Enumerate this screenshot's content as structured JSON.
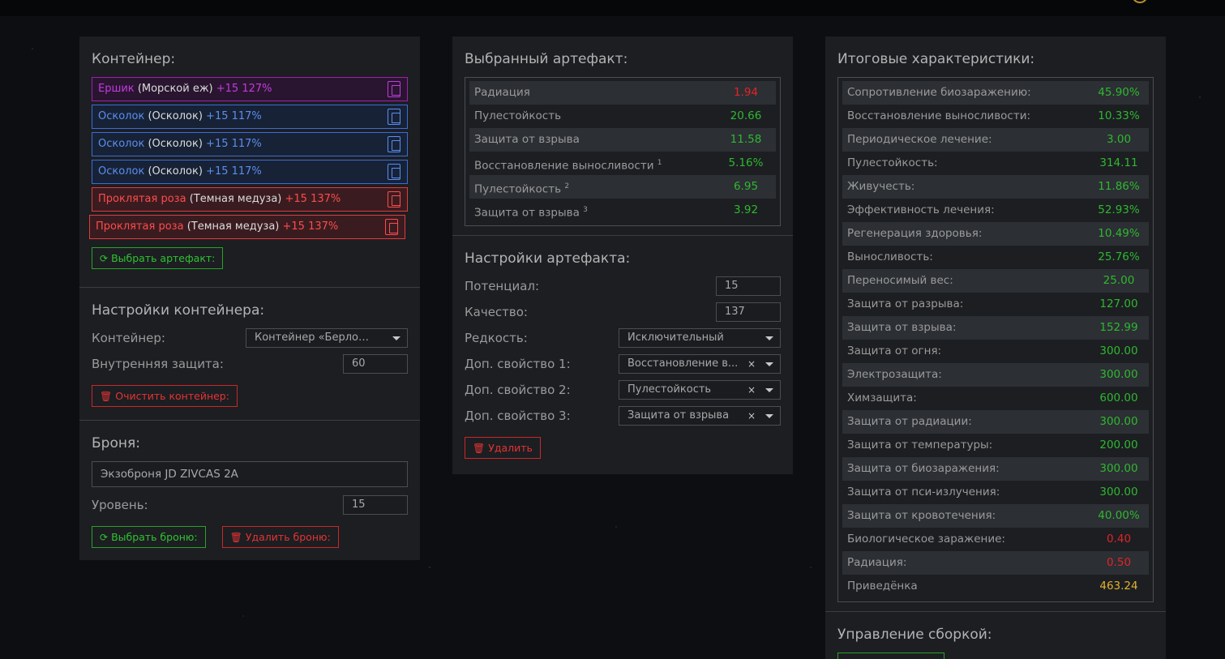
{
  "container_panel": {
    "title": "Контейнер:",
    "items": [
      {
        "name": "Ершик",
        "base": "(Морской еж)",
        "level": "+15 127%",
        "color": "purple"
      },
      {
        "name": "Осколок",
        "base": "(Осколок)",
        "level": "+15 117%",
        "color": "blue"
      },
      {
        "name": "Осколок",
        "base": "(Осколок)",
        "level": "+15 117%",
        "color": "blue"
      },
      {
        "name": "Осколок",
        "base": "(Осколок)",
        "level": "+15 117%",
        "color": "blue"
      },
      {
        "name": "Проклятая роза",
        "base": "(Темная медуза)",
        "level": "+15 137%",
        "color": "red"
      },
      {
        "name": "Проклятая роза",
        "base": "(Темная медуза)",
        "level": "+15 137%",
        "color": "red"
      }
    ],
    "select_artifact_button": "Выбрать артефакт:",
    "settings_title": "Настройки контейнера:",
    "container_label": "Контейнер:",
    "container_value": "Контейнер «Берлога...",
    "inner_protection_label": "Внутренняя защита:",
    "inner_protection_value": "60",
    "clear_button": "Очистить контейнер:"
  },
  "armor_panel": {
    "title": "Броня:",
    "armor_value": "Экзоброня JD ZIVCAS 2A",
    "level_label": "Уровень:",
    "level_value": "15",
    "select_button": "Выбрать броню:",
    "delete_button": "Удалить броню:"
  },
  "artifact_panel": {
    "title": "Выбранный артефакт:",
    "stats": [
      {
        "label": "Радиация",
        "sup": "",
        "value": "1.94",
        "color": "red"
      },
      {
        "label": "Пулестойкость",
        "sup": "",
        "value": "20.66",
        "color": "green"
      },
      {
        "label": "Защита от взрыва",
        "sup": "",
        "value": "11.58",
        "color": "green"
      },
      {
        "label": "Восстановление выносливости",
        "sup": "1",
        "value": "5.16%",
        "color": "green"
      },
      {
        "label": "Пулестойкость",
        "sup": "2",
        "value": "6.95",
        "color": "green"
      },
      {
        "label": "Защита от взрыва",
        "sup": "3",
        "value": "3.92",
        "color": "green"
      }
    ],
    "settings_title": "Настройки артефакта:",
    "potential_label": "Потенциал:",
    "potential_value": "15",
    "quality_label": "Качество:",
    "quality_value": "137",
    "rarity_label": "Редкость:",
    "rarity_value": "Исключительный",
    "extra1_label": "Доп. свойство 1:",
    "extra1_value": "Восстановление в...",
    "extra2_label": "Доп. свойство 2:",
    "extra2_value": "Пулестойкость",
    "extra3_label": "Доп. свойство 3:",
    "extra3_value": "Защита от взрыва",
    "clear_x": "×",
    "delete_button": "Удалить"
  },
  "totals_panel": {
    "title": "Итоговые характеристики:",
    "stats": [
      {
        "label": "Сопротивление биозаражению:",
        "value": "45.90%",
        "color": "green"
      },
      {
        "label": "Восстановление выносливости:",
        "value": "10.33%",
        "color": "green"
      },
      {
        "label": "Периодическое лечение:",
        "value": "3.00",
        "color": "green"
      },
      {
        "label": "Пулестойкость:",
        "value": "314.11",
        "color": "green"
      },
      {
        "label": "Живучесть:",
        "value": "11.86%",
        "color": "green"
      },
      {
        "label": "Эффективность лечения:",
        "value": "52.93%",
        "color": "green"
      },
      {
        "label": "Регенерация здоровья:",
        "value": "10.49%",
        "color": "green"
      },
      {
        "label": "Выносливость:",
        "value": "25.76%",
        "color": "green"
      },
      {
        "label": "Переносимый вес:",
        "value": "25.00",
        "color": "green"
      },
      {
        "label": "Защита от разрыва:",
        "value": "127.00",
        "color": "green"
      },
      {
        "label": "Защита от взрыва:",
        "value": "152.99",
        "color": "green"
      },
      {
        "label": "Защита от огня:",
        "value": "300.00",
        "color": "green"
      },
      {
        "label": "Электрозащита:",
        "value": "300.00",
        "color": "green"
      },
      {
        "label": "Химзащита:",
        "value": "600.00",
        "color": "green"
      },
      {
        "label": "Защита от радиации:",
        "value": "300.00",
        "color": "green"
      },
      {
        "label": "Защита от температуры:",
        "value": "200.00",
        "color": "green"
      },
      {
        "label": "Защита от биозаражения:",
        "value": "300.00",
        "color": "green"
      },
      {
        "label": "Защита от пси-излучения:",
        "value": "300.00",
        "color": "green"
      },
      {
        "label": "Защита от кровотечения:",
        "value": "40.00%",
        "color": "green"
      },
      {
        "label": "Биологическое заражение:",
        "value": "0.40",
        "color": "red"
      },
      {
        "label": "Радиация:",
        "value": "0.50",
        "color": "red"
      },
      {
        "label": "Приведёнка",
        "value": "463.24",
        "color": "gold"
      }
    ],
    "build_title": "Управление сборкой:"
  },
  "colors": {
    "green": "#2fb82f",
    "red": "#e02525",
    "gold": "#e3b12c",
    "purple": "#c23be0",
    "blue": "#5b8ef0"
  }
}
